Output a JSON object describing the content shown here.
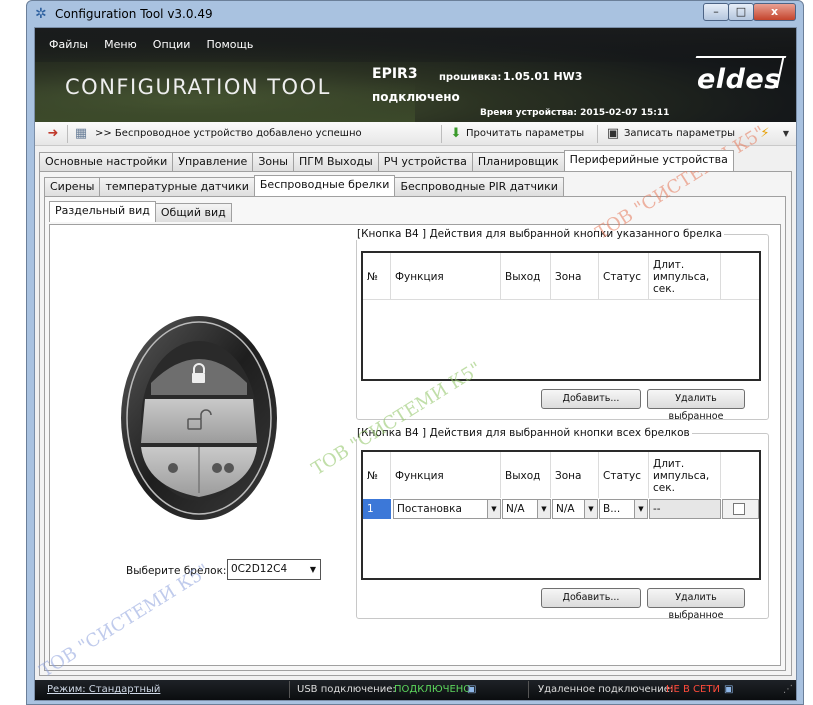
{
  "window": {
    "title": "Configuration Tool v3.0.49",
    "minimize": "–",
    "maximize": "□",
    "close": "x"
  },
  "menu": [
    "Файлы",
    "Меню",
    "Опции",
    "Помощь"
  ],
  "banner": {
    "app_title": "CONFIGURATION TOOL",
    "device": "EPIR3",
    "firmware_label": "прошивка:",
    "firmware_value": "1.05.01 HW3",
    "connection": "подключено",
    "device_time": "Время устройства: 2015-02-07 15:11",
    "brand": "eldes"
  },
  "toolbar": {
    "status_message": ">> Беспроводное устройство добавлено успешно",
    "read_label": "Прочитать параметры",
    "write_label": "Записать параметры"
  },
  "main_tabs": [
    "Основные настройки",
    "Управление",
    "Зоны",
    "ПГМ Выходы",
    "РЧ устройства",
    "Планировщик",
    "Периферийные устройства"
  ],
  "sub_tabs": [
    "Сирены",
    "температурные датчики",
    "Беспроводные брелки",
    "Беспроводные PIR датчики"
  ],
  "view_tabs": [
    "Раздельный вид",
    "Общий вид"
  ],
  "keyfob": {
    "select_label": "Выберите брелок:",
    "selected": "0C2D12C4"
  },
  "group1": {
    "title": "[Кнопка В4 ]  Действия для выбранной кнопки указанного брелка",
    "columns": [
      "№",
      "Функция",
      "Выход",
      "Зона",
      "Статус",
      "Длит. импульса, сек."
    ],
    "add_button": "Добавить...",
    "delete_button": "Удалить выбранное"
  },
  "group2": {
    "title": "[Кнопка В4 ]  Действия для выбранной кнопки всех брелков",
    "columns": [
      "№",
      "Функция",
      "Выход",
      "Зона",
      "Статус",
      "Длит. импульса, сек."
    ],
    "row": {
      "num": "1",
      "function": "Постановка",
      "output": "N/A",
      "zone": "N/A",
      "status": "В...",
      "duration": "--"
    },
    "add_button": "Добавить...",
    "delete_button": "Удалить выбранное"
  },
  "statusbar": {
    "mode": "Режим: Стандартный",
    "usb_label": "USB подключение:",
    "usb_value": "ПОДКЛЮЧЕНО",
    "remote_label": "Удаленное подключение:",
    "remote_value": "НЕ В СЕТИ"
  },
  "watermark": "ТОВ \"СИСТЕМИ К5\"",
  "colors": {
    "usb_ok": "#5cd65c",
    "remote_off": "#ff4a3a",
    "selection": "#3c78d8"
  }
}
